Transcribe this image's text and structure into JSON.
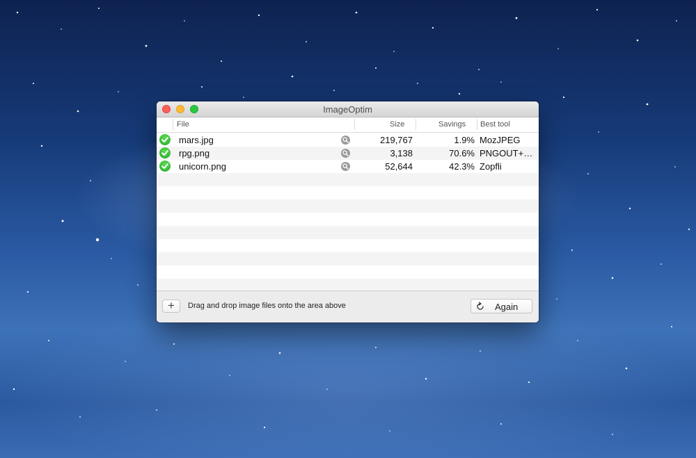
{
  "window": {
    "title": "ImageOptim"
  },
  "table": {
    "columns": {
      "file": "File",
      "size": "Size",
      "savings": "Savings",
      "best_tool": "Best tool"
    },
    "rows": [
      {
        "file": "mars.jpg",
        "size": "219,767",
        "savings": "1.9%",
        "tool": "MozJPEG",
        "status": "check-icon"
      },
      {
        "file": "rpg.png",
        "size": "3,138",
        "savings": "70.6%",
        "tool": "PNGOUT+…",
        "status": "check-icon"
      },
      {
        "file": "unicorn.png",
        "size": "52,644",
        "savings": "42.3%",
        "tool": "Zopfli",
        "status": "check-icon"
      }
    ]
  },
  "footer": {
    "add_label": "+",
    "hint": "Drag and drop image files onto the area above",
    "again_label": "Again"
  },
  "colors": {
    "close": "#fc5f57",
    "minimize": "#fdbc2e",
    "maximize": "#28c840",
    "success": "#25a72d"
  }
}
